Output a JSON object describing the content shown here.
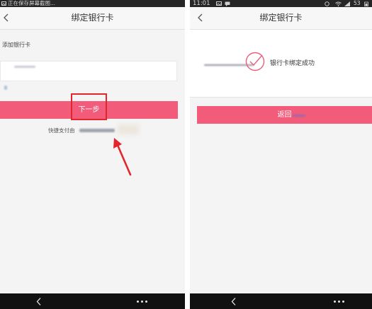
{
  "theme": {
    "accent_color": "#f35b7a",
    "annotation_color": "#e3262d",
    "background_color": "#f4f4f4",
    "status_bar_color": "#262626",
    "nav_bar_color": "#111111"
  },
  "left_screen": {
    "status_bar": {
      "icon": "image-icon",
      "notification": "正在保存屏幕截图..."
    },
    "header": {
      "back_icon": "chevron-left-icon",
      "title": "绑定银行卡"
    },
    "form": {
      "section_label": "添加银行卡",
      "card_input_value": "",
      "next_button": "下一步"
    },
    "footnote": "快捷支付由",
    "annotation_icons": [
      "highlight-box-icon",
      "red-arrow-icon"
    ],
    "nav_bar": {
      "back_icon": "chevron-left-icon",
      "more_icon": "more-dots-icon"
    }
  },
  "right_screen": {
    "status_bar": {
      "time": "11:01",
      "battery": "53",
      "icons": [
        "image-icon",
        "message-icon",
        "alarm-icon",
        "wifi-icon",
        "signal-icon",
        "battery-icon"
      ]
    },
    "header": {
      "back_icon": "chevron-left-icon",
      "title": "绑定银行卡"
    },
    "result": {
      "icon": "check-circle-icon",
      "message": "银行卡绑定成功"
    },
    "back_button": "返回",
    "nav_bar": {
      "back_icon": "chevron-left-icon",
      "more_icon": "more-dots-icon"
    }
  }
}
